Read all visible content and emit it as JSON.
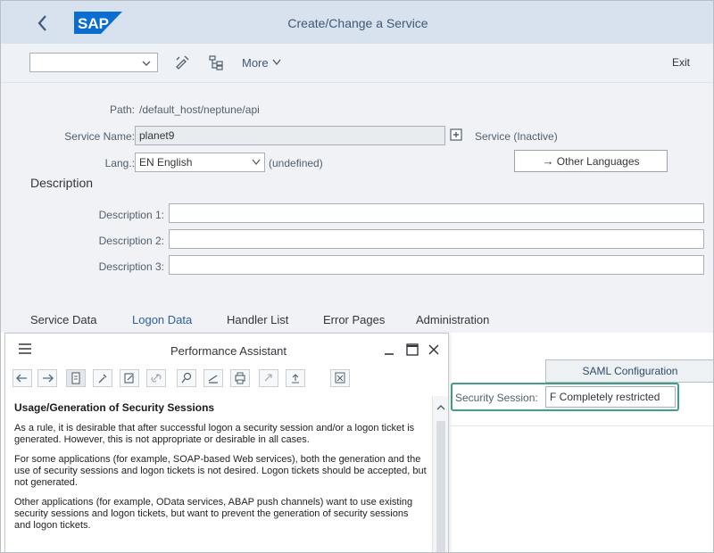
{
  "shell": {
    "title": "Create/Change a Service",
    "logo": "SAP",
    "brand_color": "#0a6ed1"
  },
  "toolbar": {
    "select_value": "",
    "more_label": "More",
    "exit_label": "Exit"
  },
  "form": {
    "path_label": "Path:",
    "path_value": "/default_host/neptune/api",
    "service_name_label": "Service Name:",
    "service_name_value": "planet9",
    "service_status": "Service (Inactive)",
    "lang_label": "Lang.:",
    "lang_value": "EN English",
    "lang_note": "(undefined)",
    "other_languages_label": "Other Languages",
    "description_title": "Description",
    "desc1_label": "Description 1:",
    "desc2_label": "Description 2:",
    "desc3_label": "Description 3:"
  },
  "tabs": [
    {
      "label": "Service Data"
    },
    {
      "label": "Logon Data"
    },
    {
      "label": "Handler List"
    },
    {
      "label": "Error Pages"
    },
    {
      "label": "Administration"
    }
  ],
  "content": {
    "saml_button": "SAML Configuration",
    "security_session_label": "Security Session:",
    "security_session_value": "F Completely restricted",
    "highlight_color": "#3fa08a"
  },
  "assistant": {
    "title": "Performance Assistant",
    "heading": "Usage/Generation of Security Sessions",
    "paragraphs": [
      "As a rule, it is desirable that after successful logon a security session and/or a logon ticket is generated. However, this is not appropriate or desirable in all cases.",
      "For some applications (for example, SOAP-based Web services), both the generation and the use of security sessions and logon tickets is not desired. Logon tickets should be accepted, but not generated.",
      "Other applications (for example, OData services, ABAP push channels) want to use existing security sessions and logon tickets, but want to prevent the generation of security sessions and logon tickets."
    ]
  }
}
